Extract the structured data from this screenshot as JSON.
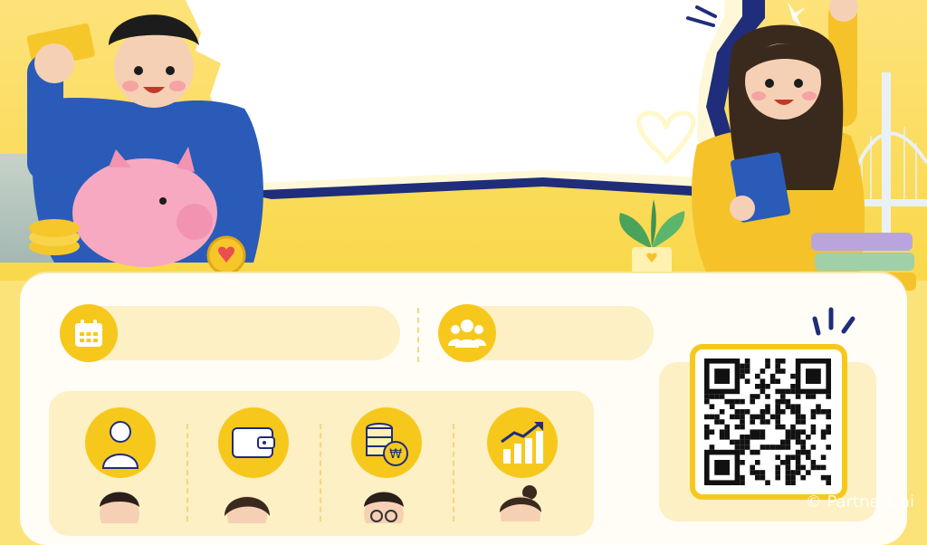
{
  "watermark": "© Partners.ai",
  "header": {
    "speech_bubble_text": ""
  },
  "info_row": [
    {
      "icon": "calendar-icon",
      "text": ""
    },
    {
      "icon": "people-icon",
      "text": ""
    }
  ],
  "stats_items": [
    {
      "icon": "person-icon"
    },
    {
      "icon": "wallet-icon"
    },
    {
      "icon": "coin-stack-won-icon"
    },
    {
      "icon": "growth-chart-icon"
    }
  ],
  "colors": {
    "accent": "#f7c81c",
    "navy": "#1f2d7a",
    "background": "#fbe37a",
    "card": "#fffdf6"
  }
}
